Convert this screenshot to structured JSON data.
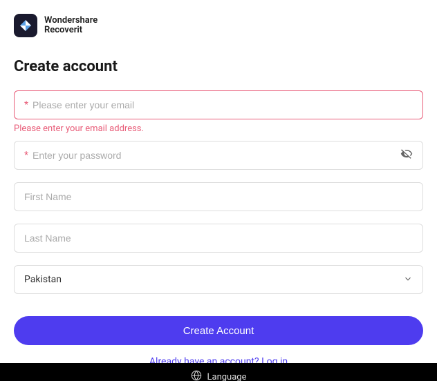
{
  "brand": {
    "line1": "Wondershare",
    "line2": "Recoverit"
  },
  "title": "Create account",
  "form": {
    "email": {
      "placeholder": "Please enter your email",
      "required_mark": "*",
      "error": "Please enter your email address."
    },
    "password": {
      "placeholder": "Enter your password",
      "required_mark": "*"
    },
    "first_name": {
      "placeholder": "First Name"
    },
    "last_name": {
      "placeholder": "Last Name"
    },
    "country": {
      "selected": "Pakistan"
    },
    "submit_label": "Create Account"
  },
  "login_link": {
    "text": "Already have an account? Log in"
  },
  "footer": {
    "language_label": "Language"
  }
}
